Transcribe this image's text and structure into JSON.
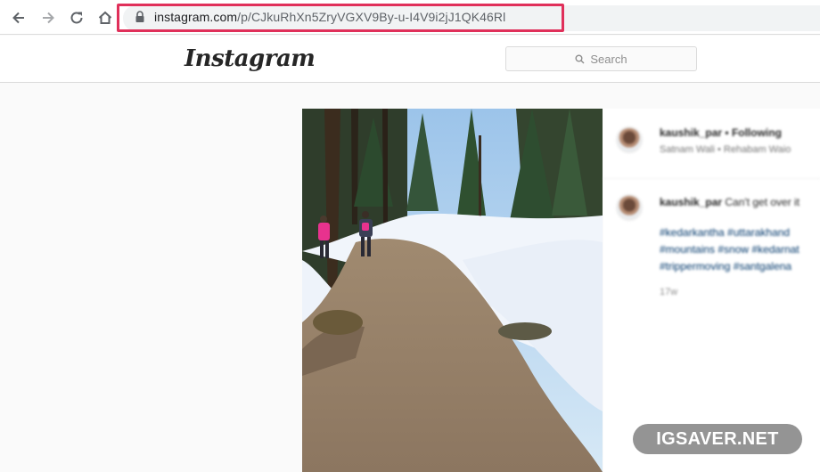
{
  "browser": {
    "url_domain": "instagram.com",
    "url_path": "/p/CJkuRhXn5ZryVGXV9By-u-I4V9i2jJ1QK46Rl",
    "highlight_color": "#e0305a"
  },
  "header": {
    "logo_text": "Instagram",
    "search_placeholder": "Search"
  },
  "post": {
    "username": "kaushik_par",
    "separator": "•",
    "follow_status": "Following",
    "location": "Satnam Wali • Rehabam Waio",
    "caption_user": "kaushik_par",
    "caption_text": "Can't get over it",
    "hashtags": "#kedarkantha #uttarakhand #mountains #snow #kedarnat #trippermoving #santgalena",
    "time_ago": "17w"
  },
  "watermark": "IGSAVER.NET"
}
